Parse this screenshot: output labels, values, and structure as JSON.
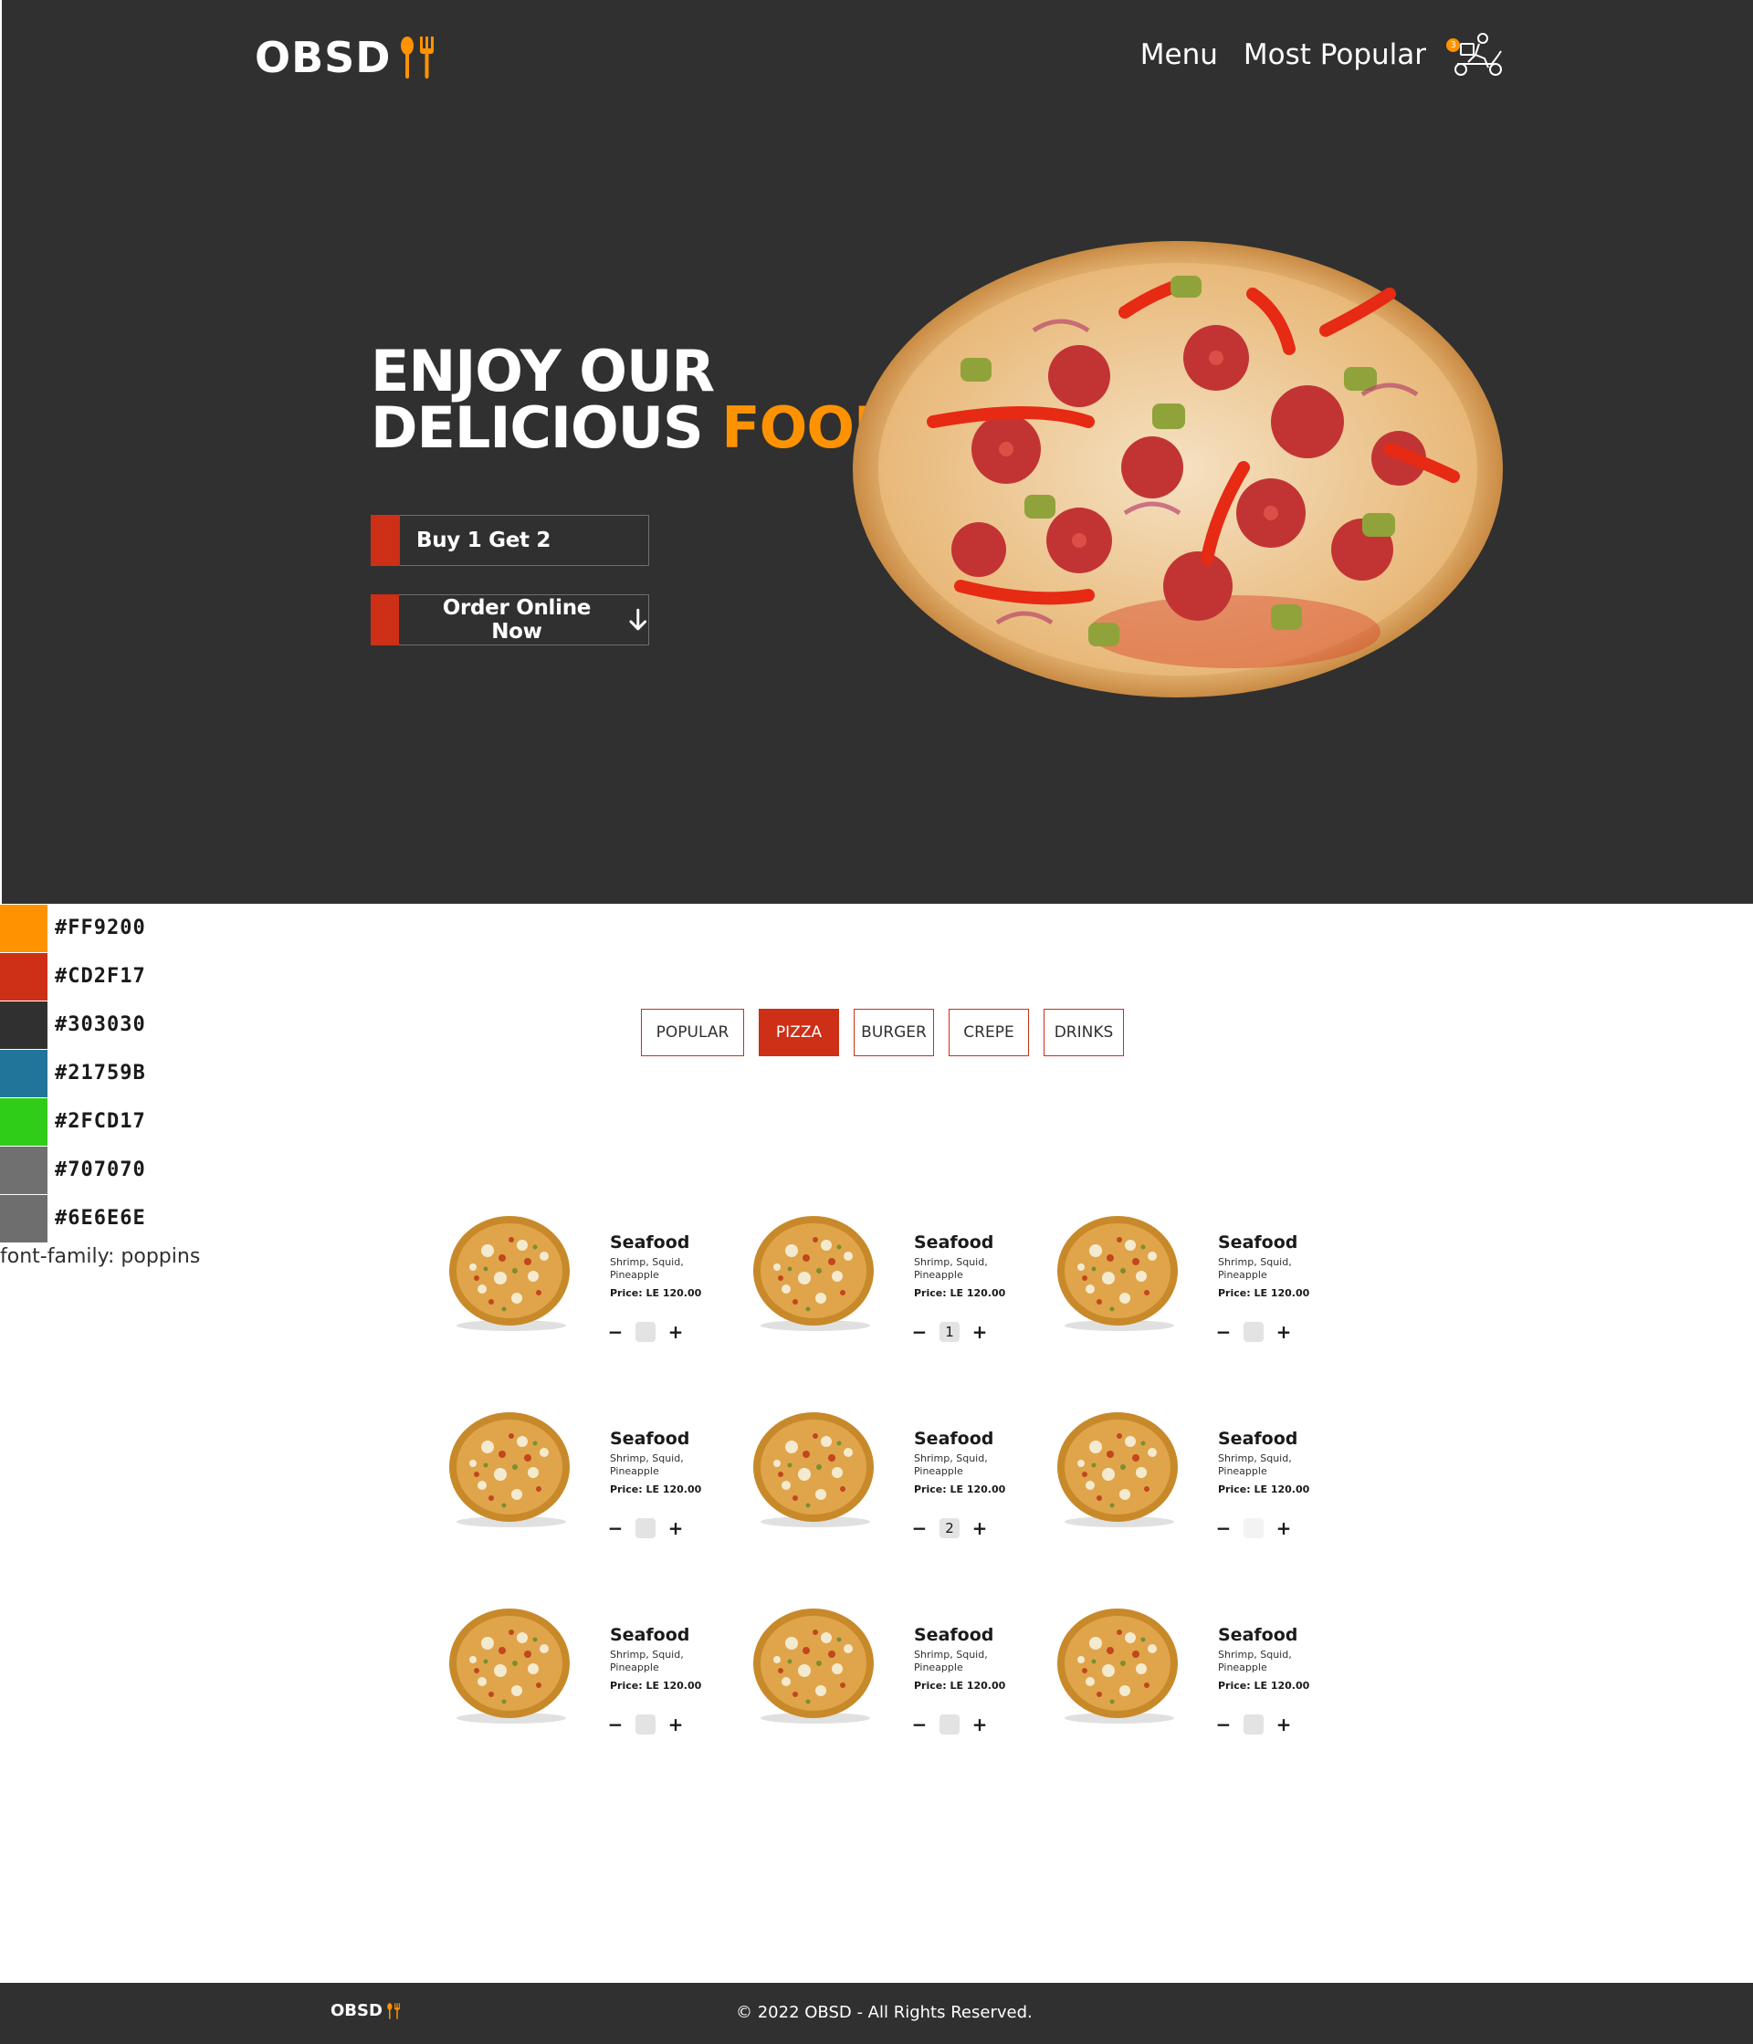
{
  "brand": {
    "logo_text": "OBSD"
  },
  "nav": {
    "menu": "Menu",
    "most_popular": "Most Popular",
    "cart_count": "3"
  },
  "hero": {
    "headline_line1": "ENJOY OUR",
    "headline_line2_white": "DELICIOUS",
    "headline_line2_accent": "FOOD",
    "btn_buy": "Buy 1 Get 2",
    "btn_order": "Order Online Now"
  },
  "palette": [
    {
      "hex": "#FF9200",
      "label": "#FF9200"
    },
    {
      "hex": "#CD2F17",
      "label": "#CD2F17"
    },
    {
      "hex": "#303030",
      "label": "#303030"
    },
    {
      "hex": "#21759B",
      "label": "#21759B"
    },
    {
      "hex": "#2FCD17",
      "label": "#2FCD17"
    },
    {
      "hex": "#707070",
      "label": "#707070"
    },
    {
      "hex": "#6E6E6E",
      "label": "#6E6E6E"
    }
  ],
  "font_note": "font-family:  poppins",
  "tabs": [
    {
      "label": "POPULAR",
      "active": false
    },
    {
      "label": "PIZZA",
      "active": true
    },
    {
      "label": "BURGER",
      "active": false
    },
    {
      "label": "CREPE",
      "active": false
    },
    {
      "label": "DRINKS",
      "active": false
    }
  ],
  "products": [
    {
      "name": "Seafood",
      "desc": "Shrimp, Squid, Pineapple",
      "price": "Price: LE 120.00",
      "qty": ""
    },
    {
      "name": "Seafood",
      "desc": "Shrimp, Squid, Pineapple",
      "price": "Price: LE 120.00",
      "qty": "1"
    },
    {
      "name": "Seafood",
      "desc": "Shrimp, Squid, Pineapple",
      "price": "Price: LE 120.00",
      "qty": ""
    },
    {
      "name": "Seafood",
      "desc": "Shrimp, Squid, Pineapple",
      "price": "Price: LE 120.00",
      "qty": ""
    },
    {
      "name": "Seafood",
      "desc": "Shrimp, Squid, Pineapple",
      "price": "Price: LE 120.00",
      "qty": "2"
    },
    {
      "name": "Seafood",
      "desc": "Shrimp, Squid, Pineapple",
      "price": "Price: LE 120.00",
      "qty": ""
    },
    {
      "name": "Seafood",
      "desc": "Shrimp, Squid, Pineapple",
      "price": "Price: LE 120.00",
      "qty": ""
    },
    {
      "name": "Seafood",
      "desc": "Shrimp, Squid, Pineapple",
      "price": "Price: LE 120.00",
      "qty": ""
    },
    {
      "name": "Seafood",
      "desc": "Shrimp, Squid, Pineapple",
      "price": "Price: LE 120.00",
      "qty": ""
    }
  ],
  "qty_controls": {
    "minus": "−",
    "plus": "+"
  },
  "footer": {
    "logo_text": "OBSD",
    "copyright": "© 2022 OBSD - All Rights Reserved."
  }
}
